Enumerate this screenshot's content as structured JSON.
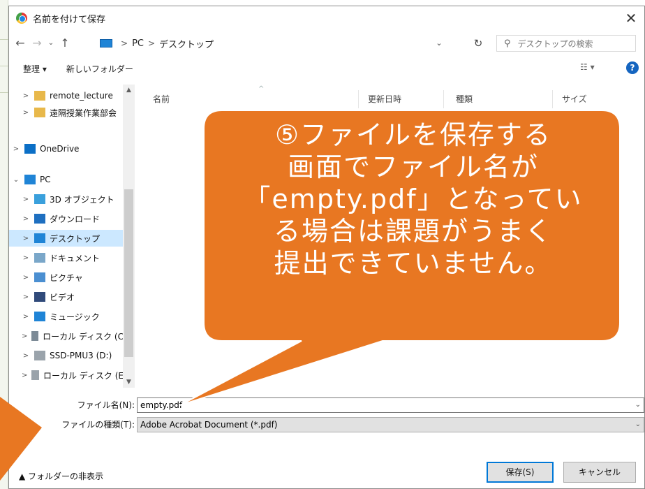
{
  "dialog": {
    "title": "名前を付けて保存",
    "close_glyph": "✕"
  },
  "nav": {
    "back_glyph": "←",
    "forward_glyph": "→",
    "recent_glyph": "⌄",
    "up_glyph": "↑",
    "breadcrumb": [
      "PC",
      "デスクトップ"
    ],
    "breadcrumb_sep": ">",
    "dropdown_glyph": "⌄",
    "refresh_glyph": "↻",
    "search_placeholder": "デスクトップの検索",
    "search_icon_glyph": "⚲"
  },
  "commands": {
    "organize": "整理 ▾",
    "new_folder": "新しいフォルダー",
    "view_glyph": "☷ ▾",
    "help_glyph": "?"
  },
  "tree": [
    {
      "label": "remote_lecture",
      "chevron": ">",
      "icon": "folder-icon",
      "color": "#e8b84a"
    },
    {
      "label": "遠隔授業作業部会",
      "chevron": ">",
      "icon": "people-folder-icon",
      "color": "#e8b84a"
    },
    {
      "label": "OneDrive",
      "chevron": ">",
      "icon": "cloud-icon",
      "color": "#0b6fc6"
    },
    {
      "label": "PC",
      "chevron": "⌄",
      "icon": "pc-icon",
      "color": "#1f84d6"
    },
    {
      "label": "3D オブジェクト",
      "chevron": ">",
      "icon": "cube-icon",
      "color": "#3aa0dc"
    },
    {
      "label": "ダウンロード",
      "chevron": ">",
      "icon": "download-icon",
      "color": "#1e6fc0"
    },
    {
      "label": "デスクトップ",
      "chevron": ">",
      "icon": "desktop-icon",
      "color": "#1f84d6"
    },
    {
      "label": "ドキュメント",
      "chevron": ">",
      "icon": "documents-icon",
      "color": "#7aa7c9"
    },
    {
      "label": "ピクチャ",
      "chevron": ">",
      "icon": "pictures-icon",
      "color": "#4b8fd1"
    },
    {
      "label": "ビデオ",
      "chevron": ">",
      "icon": "video-icon",
      "color": "#304a7a"
    },
    {
      "label": "ミュージック",
      "chevron": ">",
      "icon": "music-icon",
      "color": "#1f84d6"
    },
    {
      "label": "ローカル ディスク (C",
      "chevron": ">",
      "icon": "system-drive-icon",
      "color": "#7c8a96"
    },
    {
      "label": "SSD-PMU3 (D:)",
      "chevron": ">",
      "icon": "usb-drive-icon",
      "color": "#9aa3ab"
    },
    {
      "label": "ローカル ディスク (E",
      "chevron": ">",
      "icon": "drive-icon",
      "color": "#9aa3ab"
    }
  ],
  "selected_tree_item": "デスクトップ",
  "columns": [
    "名前",
    "更新日時",
    "種類",
    "サイズ"
  ],
  "fields": {
    "filename_label": "ファイル名(N):",
    "filename_value": "empty.pdf",
    "filetype_label": "ファイルの種類(T):",
    "filetype_value": "Adobe Acrobat Document (*.pdf)",
    "dropdown_glyph": "⌄"
  },
  "footer": {
    "hide_folders": "▲ フォルダーの非表示",
    "save": "保存(S)",
    "cancel": "キャンセル"
  },
  "annotation": {
    "lines": [
      "⑤ファイルを保存する",
      "画面でファイル名が",
      "「empty.pdf」となってい",
      "る場合は課題がうまく",
      "提出できていません。"
    ],
    "color": "#e87722"
  }
}
